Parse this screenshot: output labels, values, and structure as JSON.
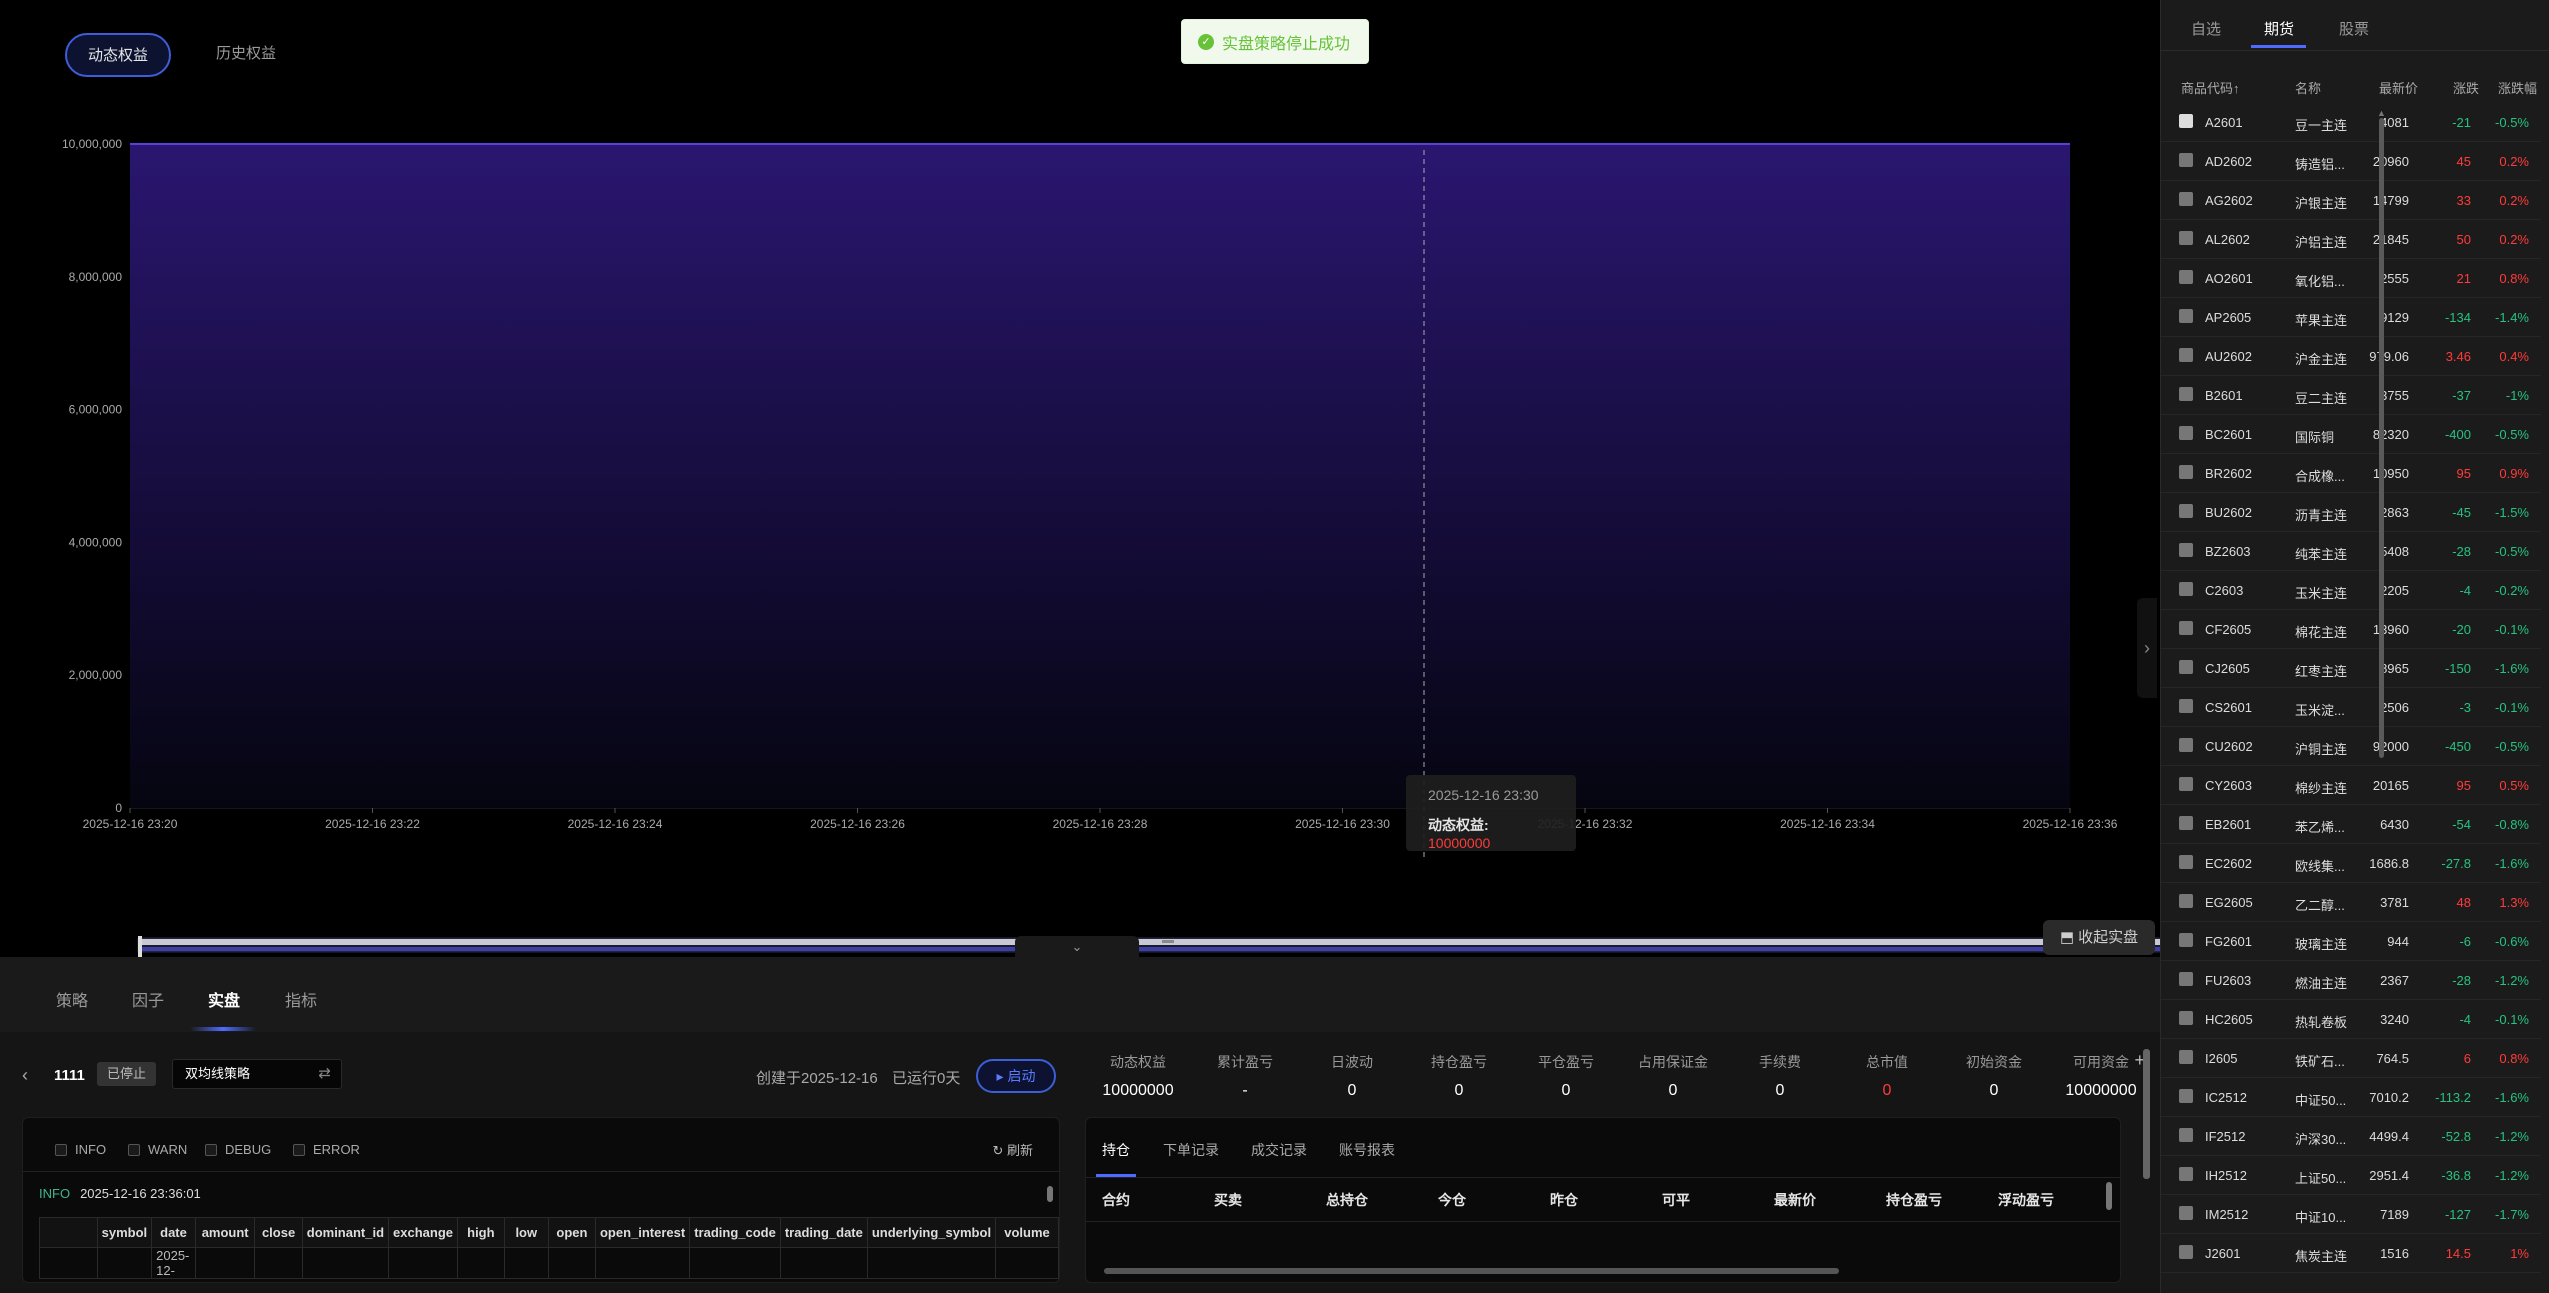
{
  "chart_tabs": {
    "dynamic": "动态权益",
    "history": "历史权益"
  },
  "toast": {
    "message": "实盘策略停止成功",
    "icon": "check-circle-icon"
  },
  "chart_data": {
    "type": "area",
    "y_ticks": [
      "10,000,000",
      "8,000,000",
      "6,000,000",
      "4,000,000",
      "2,000,000",
      "0"
    ],
    "x_ticks": [
      "2025-12-16 23:20",
      "2025-12-16 23:22",
      "2025-12-16 23:24",
      "2025-12-16 23:26",
      "2025-12-16 23:28",
      "2025-12-16 23:30",
      "2025-12-16 23:32",
      "2025-12-16 23:34",
      "2025-12-16 23:36"
    ],
    "ylim": [
      0,
      10000000
    ],
    "series": [
      {
        "name": "动态权益",
        "x": [
          "2025-12-16 23:20",
          "2025-12-16 23:36"
        ],
        "values": [
          10000000,
          10000000
        ]
      }
    ],
    "line_color": "#5b3fd8",
    "fill_color": "#2a1670",
    "grid": true
  },
  "tooltip": {
    "time": "2025-12-16 23:30",
    "label": "动态权益:",
    "value": "10000000"
  },
  "close_live_button": "收起实盘",
  "bottom_tabs": [
    "策略",
    "因子",
    "实盘",
    "指标"
  ],
  "strategy": {
    "id": "1111",
    "status": "已停止",
    "name": "双均线策略",
    "created": "创建于2025-12-16",
    "running": "已运行0天",
    "start_label": "启动"
  },
  "metrics": [
    {
      "label": "动态权益",
      "value": "10000000"
    },
    {
      "label": "累计盈亏",
      "value": "-"
    },
    {
      "label": "日波动",
      "value": "0"
    },
    {
      "label": "持仓盈亏",
      "value": "0"
    },
    {
      "label": "平仓盈亏",
      "value": "0"
    },
    {
      "label": "占用保证金",
      "value": "0"
    },
    {
      "label": "手续费",
      "value": "0"
    },
    {
      "label": "总市值",
      "value": "0",
      "color": "red"
    },
    {
      "label": "初始资金",
      "value": "0"
    },
    {
      "label": "可用资金",
      "value": "10000000"
    }
  ],
  "log": {
    "filters": [
      "INFO",
      "WARN",
      "DEBUG",
      "ERROR"
    ],
    "refresh": "刷新",
    "entry_level": "INFO",
    "entry_time": "2025-12-16 23:36:01",
    "columns": [
      "",
      "symbol",
      "date",
      "amount",
      "close",
      "dominant_id",
      "exchange",
      "high",
      "low",
      "open",
      "open_interest",
      "trading_code",
      "trading_date",
      "underlying_symbol",
      "volume"
    ],
    "first_row_date": "2025-12-"
  },
  "positions": {
    "tabs": [
      "持仓",
      "下单记录",
      "成交记录",
      "账号报表"
    ],
    "columns": [
      "合约",
      "买卖",
      "总持仓",
      "今仓",
      "昨仓",
      "可平",
      "最新价",
      "持仓盈亏",
      "浮动盈亏"
    ]
  },
  "watchlist": {
    "tabs": [
      "自选",
      "期货",
      "股票"
    ],
    "headers": [
      "商品代码↑",
      "名称",
      "最新价",
      "涨跌",
      "涨跌幅"
    ],
    "rows": [
      {
        "code": "A2601",
        "name": "豆一主连",
        "price": "4081",
        "chg": "-21",
        "pct": "-0.5%",
        "dir": "dn",
        "fav": true
      },
      {
        "code": "AD2602",
        "name": "铸造铝...",
        "price": "20960",
        "chg": "45",
        "pct": "0.2%",
        "dir": "up"
      },
      {
        "code": "AG2602",
        "name": "沪银主连",
        "price": "14799",
        "chg": "33",
        "pct": "0.2%",
        "dir": "up"
      },
      {
        "code": "AL2602",
        "name": "沪铝主连",
        "price": "21845",
        "chg": "50",
        "pct": "0.2%",
        "dir": "up"
      },
      {
        "code": "AO2601",
        "name": "氧化铝...",
        "price": "2555",
        "chg": "21",
        "pct": "0.8%",
        "dir": "up"
      },
      {
        "code": "AP2605",
        "name": "苹果主连",
        "price": "9129",
        "chg": "-134",
        "pct": "-1.4%",
        "dir": "dn"
      },
      {
        "code": "AU2602",
        "name": "沪金主连",
        "price": "979.06",
        "chg": "3.46",
        "pct": "0.4%",
        "dir": "up"
      },
      {
        "code": "B2601",
        "name": "豆二主连",
        "price": "3755",
        "chg": "-37",
        "pct": "-1%",
        "dir": "dn"
      },
      {
        "code": "BC2601",
        "name": "国际铜",
        "price": "82320",
        "chg": "-400",
        "pct": "-0.5%",
        "dir": "dn"
      },
      {
        "code": "BR2602",
        "name": "合成橡...",
        "price": "10950",
        "chg": "95",
        "pct": "0.9%",
        "dir": "up"
      },
      {
        "code": "BU2602",
        "name": "沥青主连",
        "price": "2863",
        "chg": "-45",
        "pct": "-1.5%",
        "dir": "dn"
      },
      {
        "code": "BZ2603",
        "name": "纯苯主连",
        "price": "5408",
        "chg": "-28",
        "pct": "-0.5%",
        "dir": "dn"
      },
      {
        "code": "C2603",
        "name": "玉米主连",
        "price": "2205",
        "chg": "-4",
        "pct": "-0.2%",
        "dir": "dn"
      },
      {
        "code": "CF2605",
        "name": "棉花主连",
        "price": "13960",
        "chg": "-20",
        "pct": "-0.1%",
        "dir": "dn"
      },
      {
        "code": "CJ2605",
        "name": "红枣主连",
        "price": "8965",
        "chg": "-150",
        "pct": "-1.6%",
        "dir": "dn"
      },
      {
        "code": "CS2601",
        "name": "玉米淀...",
        "price": "2506",
        "chg": "-3",
        "pct": "-0.1%",
        "dir": "dn"
      },
      {
        "code": "CU2602",
        "name": "沪铜主连",
        "price": "92000",
        "chg": "-450",
        "pct": "-0.5%",
        "dir": "dn"
      },
      {
        "code": "CY2603",
        "name": "棉纱主连",
        "price": "20165",
        "chg": "95",
        "pct": "0.5%",
        "dir": "up"
      },
      {
        "code": "EB2601",
        "name": "苯乙烯...",
        "price": "6430",
        "chg": "-54",
        "pct": "-0.8%",
        "dir": "dn"
      },
      {
        "code": "EC2602",
        "name": "欧线集...",
        "price": "1686.8",
        "chg": "-27.8",
        "pct": "-1.6%",
        "dir": "dn"
      },
      {
        "code": "EG2605",
        "name": "乙二醇...",
        "price": "3781",
        "chg": "48",
        "pct": "1.3%",
        "dir": "up"
      },
      {
        "code": "FG2601",
        "name": "玻璃主连",
        "price": "944",
        "chg": "-6",
        "pct": "-0.6%",
        "dir": "dn"
      },
      {
        "code": "FU2603",
        "name": "燃油主连",
        "price": "2367",
        "chg": "-28",
        "pct": "-1.2%",
        "dir": "dn"
      },
      {
        "code": "HC2605",
        "name": "热轧卷板",
        "price": "3240",
        "chg": "-4",
        "pct": "-0.1%",
        "dir": "dn"
      },
      {
        "code": "I2605",
        "name": "铁矿石...",
        "price": "764.5",
        "chg": "6",
        "pct": "0.8%",
        "dir": "up"
      },
      {
        "code": "IC2512",
        "name": "中证50...",
        "price": "7010.2",
        "chg": "-113.2",
        "pct": "-1.6%",
        "dir": "dn"
      },
      {
        "code": "IF2512",
        "name": "沪深30...",
        "price": "4499.4",
        "chg": "-52.8",
        "pct": "-1.2%",
        "dir": "dn"
      },
      {
        "code": "IH2512",
        "name": "上证50...",
        "price": "2951.4",
        "chg": "-36.8",
        "pct": "-1.2%",
        "dir": "dn"
      },
      {
        "code": "IM2512",
        "name": "中证10...",
        "price": "7189",
        "chg": "-127",
        "pct": "-1.7%",
        "dir": "dn"
      },
      {
        "code": "J2601",
        "name": "焦炭主连",
        "price": "1516",
        "chg": "14.5",
        "pct": "1%",
        "dir": "up"
      }
    ]
  }
}
